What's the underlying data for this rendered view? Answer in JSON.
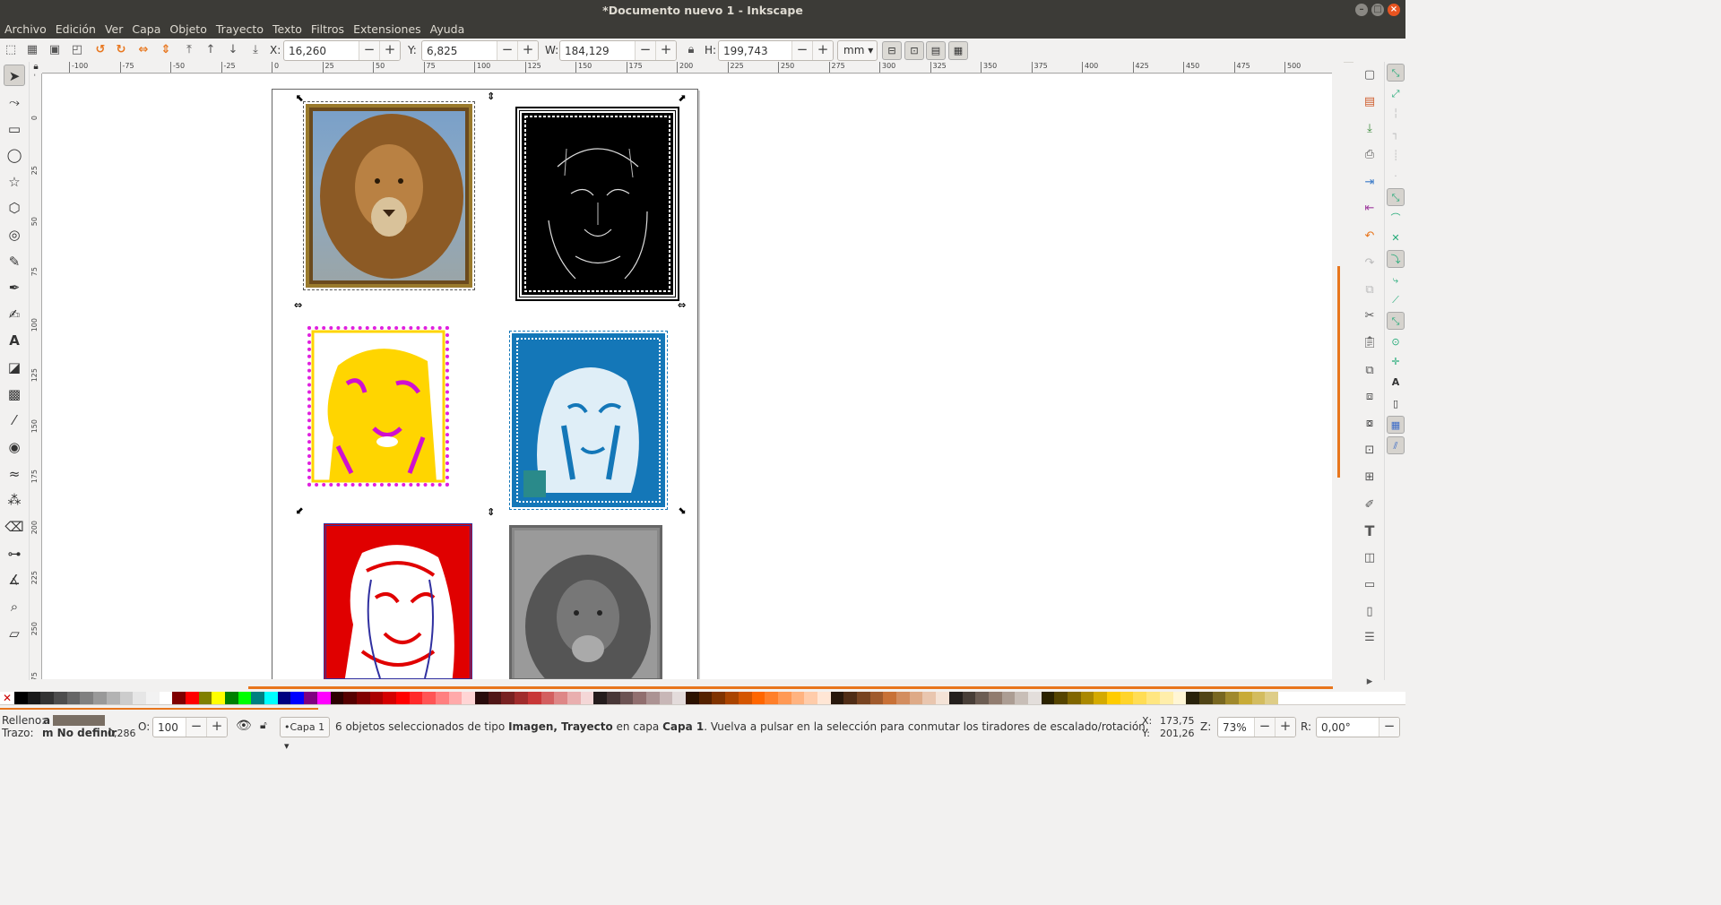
{
  "window": {
    "title": "*Documento nuevo 1 - Inkscape",
    "min": "–",
    "max": "□",
    "close": "×"
  },
  "menu": [
    "Archivo",
    "Edición",
    "Ver",
    "Capa",
    "Objeto",
    "Trayecto",
    "Texto",
    "Filtros",
    "Extensiones",
    "Ayuda"
  ],
  "controls": {
    "x_label": "X:",
    "x_value": "16,260",
    "y_label": "Y:",
    "y_value": "6,825",
    "w_label": "W:",
    "w_value": "184,129",
    "h_label": "H:",
    "h_value": "199,743",
    "minus": "−",
    "plus": "+",
    "unit": "mm"
  },
  "ruler_h": [
    "-100",
    "-75",
    "-50",
    "-25",
    "0",
    "25",
    "50",
    "75",
    "100",
    "125",
    "150",
    "175",
    "200",
    "225",
    "250",
    "275",
    "300",
    "325",
    "350",
    "375",
    "400",
    "425",
    "450",
    "475",
    "500"
  ],
  "ruler_v": [
    "-25",
    "0",
    "25",
    "50",
    "75",
    "100",
    "125",
    "150",
    "175",
    "200",
    "225",
    "250",
    "275"
  ],
  "images": [
    {
      "name": "lion-color",
      "style": "orig"
    },
    {
      "name": "lion-edges-black",
      "style": "black"
    },
    {
      "name": "lion-yellow-magenta",
      "style": "yellow"
    },
    {
      "name": "lion-blue",
      "style": "blue"
    },
    {
      "name": "lion-red",
      "style": "red"
    },
    {
      "name": "lion-gray",
      "style": "gray"
    }
  ],
  "colors": {
    "accent": "#e8761d",
    "titlebar": "#3c3b37",
    "close": "#e95420"
  },
  "palette": [
    "#000000",
    "#1a1a1a",
    "#333333",
    "#4d4d4d",
    "#666666",
    "#808080",
    "#999999",
    "#b3b3b3",
    "#cccccc",
    "#e6e6e6",
    "#f2f2f2",
    "#ffffff",
    "#800000",
    "#ff0000",
    "#808000",
    "#ffff00",
    "#008000",
    "#00ff00",
    "#008080",
    "#00ffff",
    "#000080",
    "#0000ff",
    "#800080",
    "#ff00ff",
    "#2b0000",
    "#550000",
    "#800000",
    "#aa0000",
    "#d40000",
    "#ff0000",
    "#ff2a2a",
    "#ff5555",
    "#ff8080",
    "#ffaaaa",
    "#ffd5d5",
    "#280b0b",
    "#501616",
    "#782121",
    "#a02c2c",
    "#c83737",
    "#d35f5f",
    "#de8787",
    "#e9afaf",
    "#f4d7d7",
    "#241c1c",
    "#483737",
    "#6c5353",
    "#916f6f",
    "#ac9393",
    "#c8b7b7",
    "#e3dbdb",
    "#2b1100",
    "#552200",
    "#803300",
    "#aa4400",
    "#d45500",
    "#ff6600",
    "#ff7f2a",
    "#ff9955",
    "#ffb380",
    "#ffccaa",
    "#ffe6d5",
    "#28170b",
    "#502d16",
    "#784421",
    "#a05a2c",
    "#c87137",
    "#d38d5f",
    "#deaa87",
    "#e9c6af",
    "#f4e3d7",
    "#241f1c",
    "#483e37",
    "#6c5d53",
    "#917c6f",
    "#ac9d93",
    "#c8beb7",
    "#e3dedb",
    "#2b2200",
    "#554400",
    "#806600",
    "#aa8800",
    "#d4aa00",
    "#ffcc00",
    "#ffd42a",
    "#ffdd55",
    "#ffe680",
    "#ffeeaa",
    "#fff6d5",
    "#28220b",
    "#504416",
    "#786721",
    "#a0892c",
    "#c8ab37",
    "#d3bc5f",
    "#decd87"
  ],
  "status": {
    "fill_label": "Relleno:",
    "fill_value": "a",
    "stroke_label": "Trazo:",
    "stroke_value": "m No definir",
    "stroke_width": "0,286",
    "opacity_label": "O:",
    "opacity_value": "100",
    "layer": "•Capa 1",
    "message_part1": "6 objetos seleccionados de tipo ",
    "message_bold1": "Imagen, Trayecto",
    "message_part2": " en capa ",
    "message_bold2": "Capa 1",
    "message_part3": ". Vuelva a pulsar en la selección para conmutar los tiradores de escalado/rotación.",
    "cursor_x_label": "X:",
    "cursor_x": "173,75",
    "cursor_y_label": "Y:",
    "cursor_y": "201,26",
    "zoom_label": "Z:",
    "zoom_value": "73%",
    "rotation_label": "R:",
    "rotation_value": "0,00°"
  }
}
